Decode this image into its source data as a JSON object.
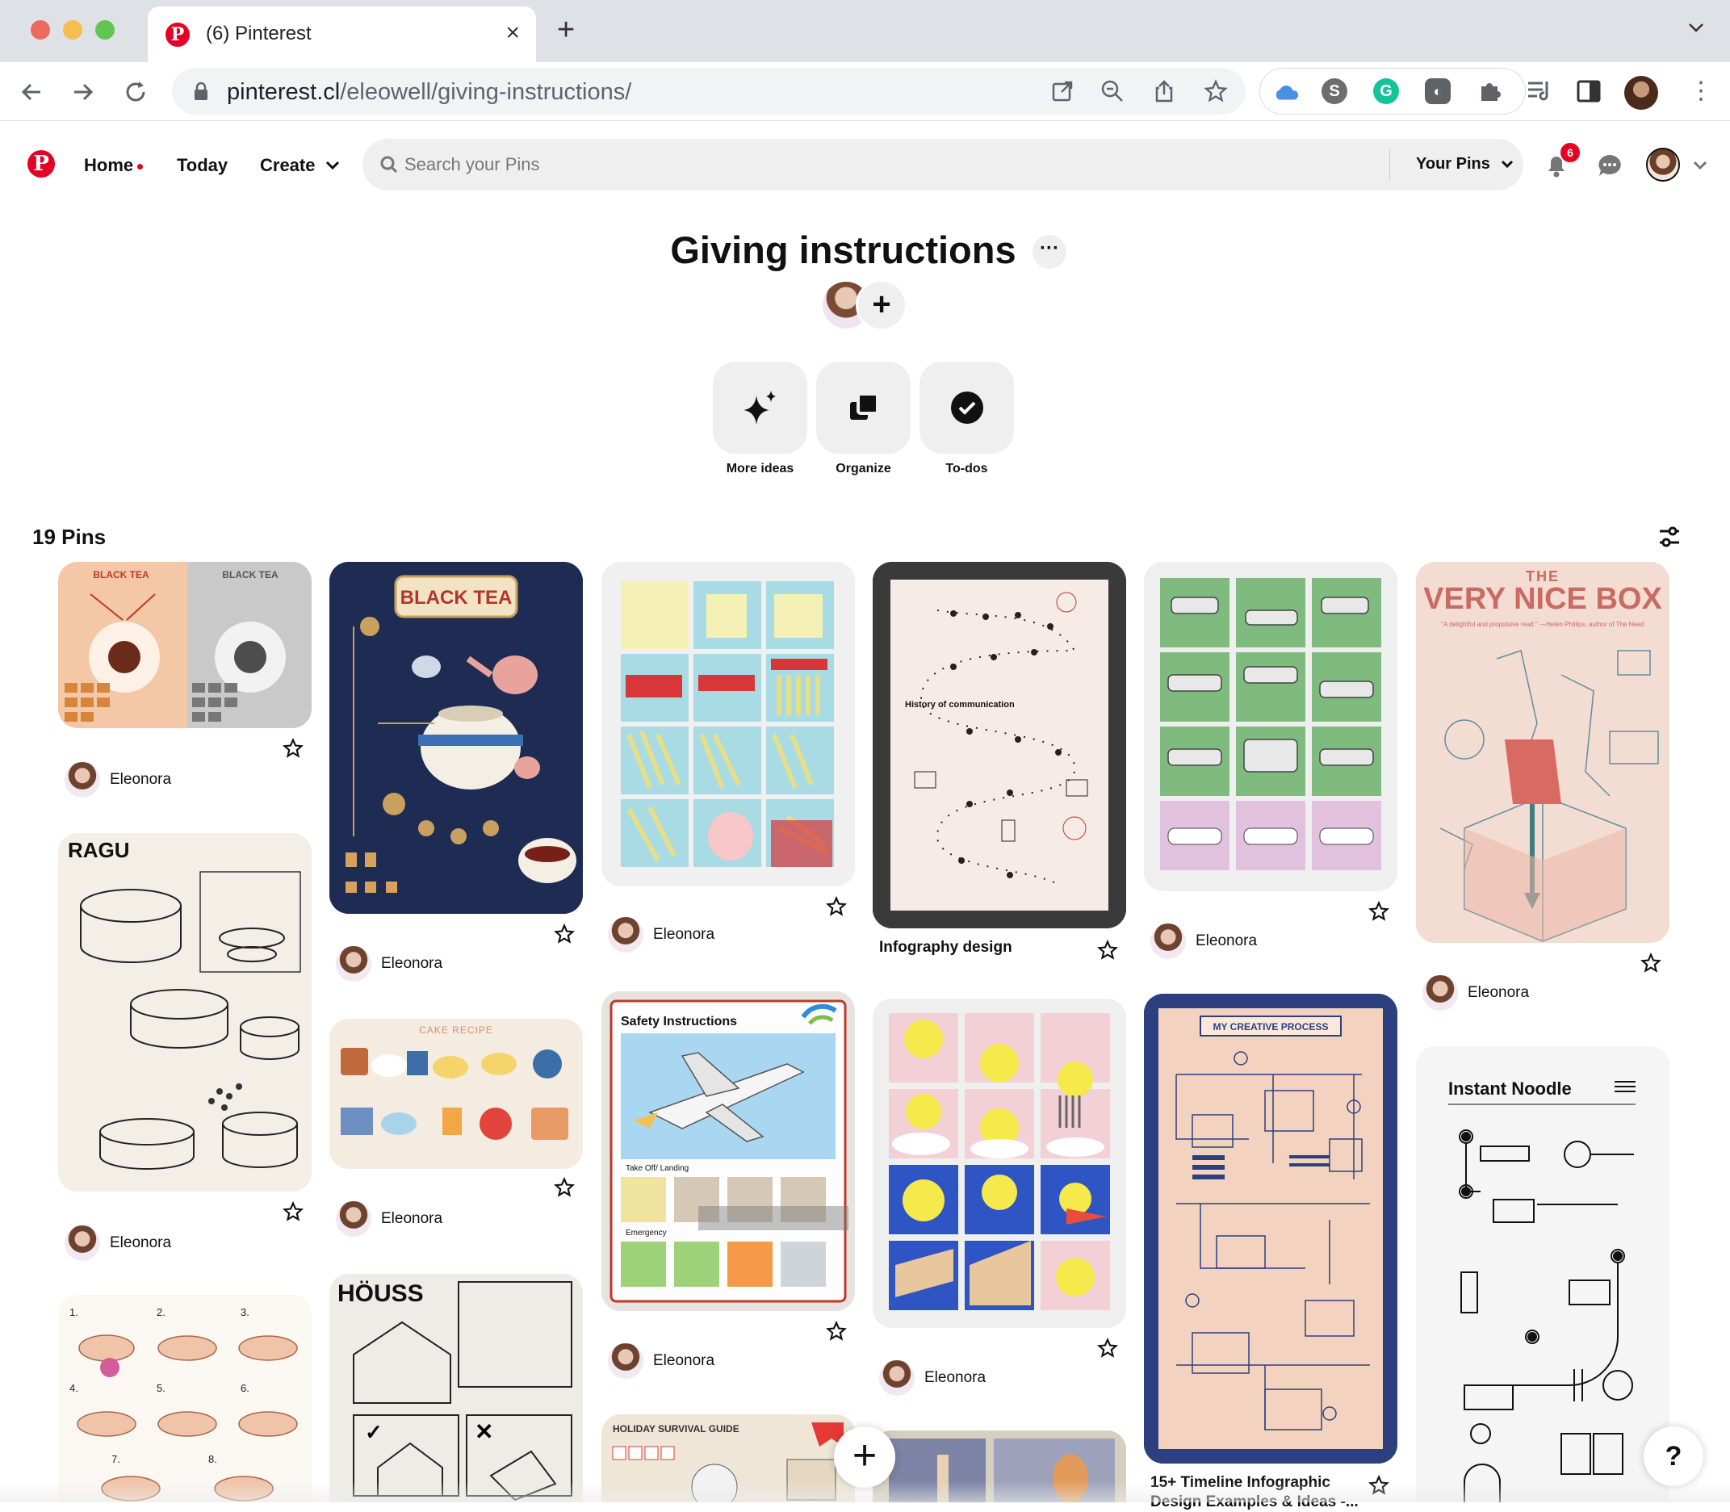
{
  "browser": {
    "tab_title": "(6) Pinterest",
    "url_domain": "pinterest.cl",
    "url_path": "/eleowell/giving-instructions/"
  },
  "header": {
    "nav": {
      "home": "Home",
      "today": "Today",
      "create": "Create"
    },
    "search_placeholder": "Search your Pins",
    "scope": "Your Pins",
    "notifications_count": "6"
  },
  "board": {
    "title": "Giving instructions",
    "actions": [
      {
        "label": "More ideas",
        "icon": "sparkle-icon"
      },
      {
        "label": "Organize",
        "icon": "organize-icon"
      },
      {
        "label": "To-dos",
        "icon": "check-circle-icon"
      }
    ],
    "pin_count": "19 Pins"
  },
  "pins": {
    "user": "Eleonora",
    "black_tea_small_1": "BLACK TEA",
    "black_tea_small_2": "BLACK TEA",
    "ragu": "RAGU",
    "black_tea": "BLACK TEA",
    "cake_recipe": "CAKE RECIPE",
    "houss": "HÖUSS",
    "safety": "Safety Instructions",
    "safety_takeoff": "Take Off/ Landing",
    "safety_emergency": "Emergency",
    "holiday": "HOLIDAY SURVIVAL GUIDE",
    "history": "History of communication",
    "infography_title": "Infography design",
    "creative": "MY CREATIVE PROCESS",
    "timeline_title": "15+ Timeline Infographic Design Examples & Ideas -...",
    "vnb_the": "THE",
    "vnb_title": "VERY NICE BOX",
    "vnb_quote": "\"A delightful and propulsive read.\" —Helen Phillips, author of The Need",
    "noodle": "Instant Noodle"
  },
  "colors": {
    "brand": "#e60023",
    "pill_bg": "#efefef"
  }
}
